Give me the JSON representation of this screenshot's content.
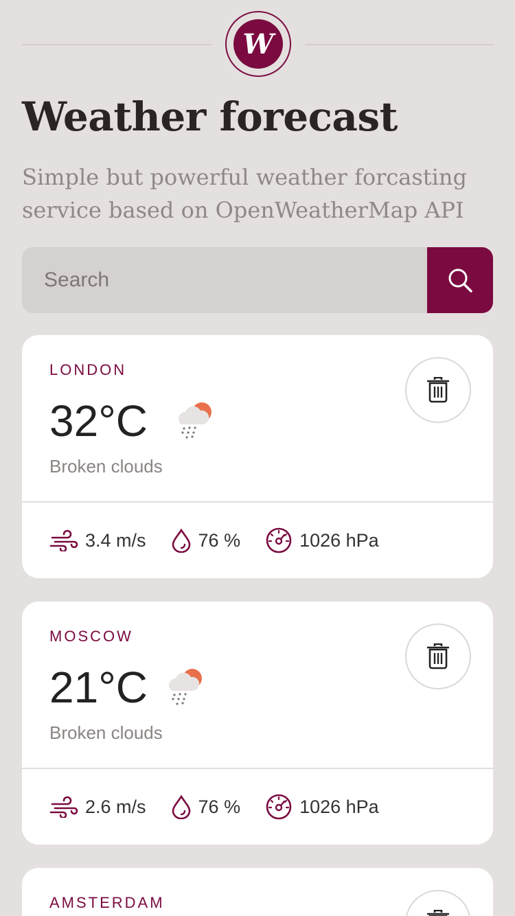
{
  "header": {
    "logo_letter": "W",
    "title": "Weather forecast",
    "subtitle": "Simple but powerful weather forcasting service based on OpenWeatherMap API"
  },
  "search": {
    "placeholder": "Search",
    "value": ""
  },
  "colors": {
    "accent": "#7a0a40",
    "background": "#e4e0df",
    "card": "#ffffff",
    "sun": "#e8704c"
  },
  "icons": [
    "logo-icon",
    "search-icon",
    "trash-icon",
    "cloud-rain-sun-icon",
    "wind-icon",
    "humidity-drop-icon",
    "pressure-gauge-icon"
  ],
  "cities": [
    {
      "name": "LONDON",
      "temperature": "32°C",
      "condition": "Broken clouds",
      "wind": "3.4 m/s",
      "humidity": "76 %",
      "pressure": "1026 hPa"
    },
    {
      "name": "MOSCOW",
      "temperature": "21°C",
      "condition": "Broken clouds",
      "wind": "2.6 m/s",
      "humidity": "76 %",
      "pressure": "1026 hPa"
    },
    {
      "name": "AMSTERDAM"
    }
  ]
}
